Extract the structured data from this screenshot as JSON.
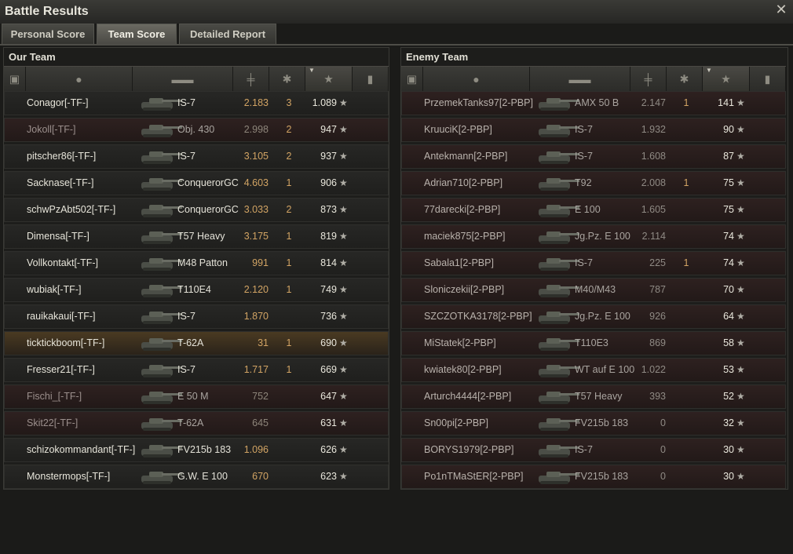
{
  "window": {
    "title": "Battle Results",
    "close_icon": "close-icon"
  },
  "tabs": [
    {
      "label": "Personal Score",
      "active": false
    },
    {
      "label": "Team Score",
      "active": true
    },
    {
      "label": "Detailed Report",
      "active": false
    }
  ],
  "colors": {
    "accent": "#d2a464",
    "dead_row": "#2e2120",
    "player_row": "#4a3a22"
  },
  "our_team": {
    "title": "Our Team",
    "columns": [
      "platoon-icon",
      "player-icon",
      "tank-icon",
      "damage-icon",
      "kills-icon",
      "experience-star-icon",
      "medal-icon"
    ],
    "rows": [
      {
        "player": "Conagor[-TF-]",
        "tank": "IS-7",
        "damage": "2.183",
        "kills": "3",
        "exp": "1.089",
        "state": "alive"
      },
      {
        "player": "Jokoll[-TF-]",
        "tank": "Obj. 430",
        "damage": "2.998",
        "kills": "2",
        "exp": "947",
        "state": "dead"
      },
      {
        "player": "pitscher86[-TF-]",
        "tank": "IS-7",
        "damage": "3.105",
        "kills": "2",
        "exp": "937",
        "state": "alive"
      },
      {
        "player": "Sacknase[-TF-]",
        "tank": "ConquerorGC",
        "damage": "4.603",
        "kills": "1",
        "exp": "906",
        "state": "alive"
      },
      {
        "player": "schwPzAbt502[-TF-]",
        "tank": "ConquerorGC",
        "damage": "3.033",
        "kills": "2",
        "exp": "873",
        "state": "alive"
      },
      {
        "player": "Dimensa[-TF-]",
        "tank": "T57 Heavy",
        "damage": "3.175",
        "kills": "1",
        "exp": "819",
        "state": "alive"
      },
      {
        "player": "Vollkontakt[-TF-]",
        "tank": "M48 Patton",
        "damage": "991",
        "kills": "1",
        "exp": "814",
        "state": "alive"
      },
      {
        "player": "wubiak[-TF-]",
        "tank": "T110E4",
        "damage": "2.120",
        "kills": "1",
        "exp": "749",
        "state": "alive"
      },
      {
        "player": "rauikakaui[-TF-]",
        "tank": "IS-7",
        "damage": "1.870",
        "kills": "",
        "exp": "736",
        "state": "alive"
      },
      {
        "player": "ticktickboom[-TF-]",
        "tank": "T-62A",
        "damage": "31",
        "kills": "1",
        "exp": "690",
        "state": "me"
      },
      {
        "player": "Fresser21[-TF-]",
        "tank": "IS-7",
        "damage": "1.717",
        "kills": "1",
        "exp": "669",
        "state": "alive"
      },
      {
        "player": "Fischi_[-TF-]",
        "tank": "E 50 M",
        "damage": "752",
        "kills": "",
        "exp": "647",
        "state": "dead"
      },
      {
        "player": "Skit22[-TF-]",
        "tank": "T-62A",
        "damage": "645",
        "kills": "",
        "exp": "631",
        "state": "dead"
      },
      {
        "player": "schizokommandant[-TF-]",
        "tank": "FV215b 183",
        "damage": "1.096",
        "kills": "",
        "exp": "626",
        "state": "alive"
      },
      {
        "player": "Monstermops[-TF-]",
        "tank": "G.W. E 100",
        "damage": "670",
        "kills": "",
        "exp": "623",
        "state": "alive"
      }
    ]
  },
  "enemy_team": {
    "title": "Enemy Team",
    "columns": [
      "platoon-icon",
      "player-icon",
      "tank-icon",
      "damage-icon",
      "kills-icon",
      "experience-star-icon",
      "medal-icon"
    ],
    "rows": [
      {
        "player": "PrzemekTanks97[2-PBP]",
        "tank": "AMX 50 B",
        "damage": "2.147",
        "kills": "1",
        "exp": "141"
      },
      {
        "player": "KruuciK[2-PBP]",
        "tank": "IS-7",
        "damage": "1.932",
        "kills": "",
        "exp": "90"
      },
      {
        "player": "Antekmann[2-PBP]",
        "tank": "IS-7",
        "damage": "1.608",
        "kills": "",
        "exp": "87"
      },
      {
        "player": "Adrian710[2-PBP]",
        "tank": "T92",
        "damage": "2.008",
        "kills": "1",
        "exp": "75"
      },
      {
        "player": "77darecki[2-PBP]",
        "tank": "E 100",
        "damage": "1.605",
        "kills": "",
        "exp": "75"
      },
      {
        "player": "maciek875[2-PBP]",
        "tank": "Jg.Pz. E 100",
        "damage": "2.114",
        "kills": "",
        "exp": "74"
      },
      {
        "player": "Sabala1[2-PBP]",
        "tank": "IS-7",
        "damage": "225",
        "kills": "1",
        "exp": "74"
      },
      {
        "player": "Sloniczekii[2-PBP]",
        "tank": "M40/M43",
        "damage": "787",
        "kills": "",
        "exp": "70"
      },
      {
        "player": "SZCZOTKA3178[2-PBP]",
        "tank": "Jg.Pz. E 100",
        "damage": "926",
        "kills": "",
        "exp": "64"
      },
      {
        "player": "MiStatek[2-PBP]",
        "tank": "T110E3",
        "damage": "869",
        "kills": "",
        "exp": "58"
      },
      {
        "player": "kwiatek80[2-PBP]",
        "tank": "WT auf E 100",
        "damage": "1.022",
        "kills": "",
        "exp": "53"
      },
      {
        "player": "Arturch4444[2-PBP]",
        "tank": "T57 Heavy",
        "damage": "393",
        "kills": "",
        "exp": "52"
      },
      {
        "player": "Sn00pi[2-PBP]",
        "tank": "FV215b 183",
        "damage": "0",
        "kills": "",
        "exp": "32"
      },
      {
        "player": "BORYS1979[2-PBP]",
        "tank": "IS-7",
        "damage": "0",
        "kills": "",
        "exp": "30"
      },
      {
        "player": "Po1nTMaStER[2-PBP]",
        "tank": "FV215b 183",
        "damage": "0",
        "kills": "",
        "exp": "30"
      }
    ]
  }
}
